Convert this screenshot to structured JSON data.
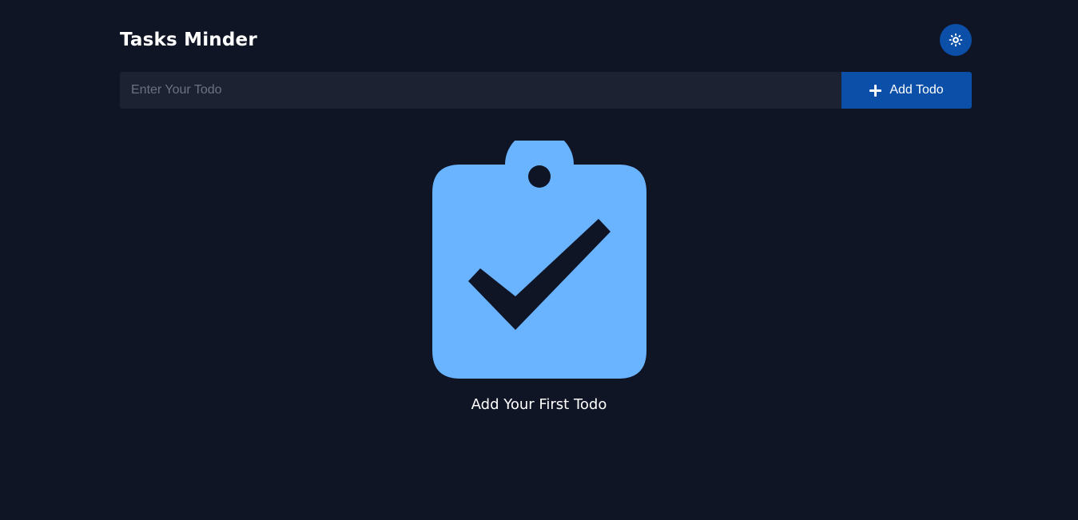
{
  "header": {
    "title": "Tasks Minder",
    "theme_toggle_icon": "sun-icon"
  },
  "form": {
    "input_placeholder": "Enter Your Todo",
    "input_value": "",
    "add_button_label": "Add Todo",
    "add_button_icon": "plus-icon"
  },
  "empty_state": {
    "icon": "clipboard-check-icon",
    "message": "Add Your First Todo"
  },
  "colors": {
    "background": "#0f1525",
    "input_background": "#1d2232",
    "accent": "#0b4fa8",
    "illustration": "#6ab3ff"
  }
}
